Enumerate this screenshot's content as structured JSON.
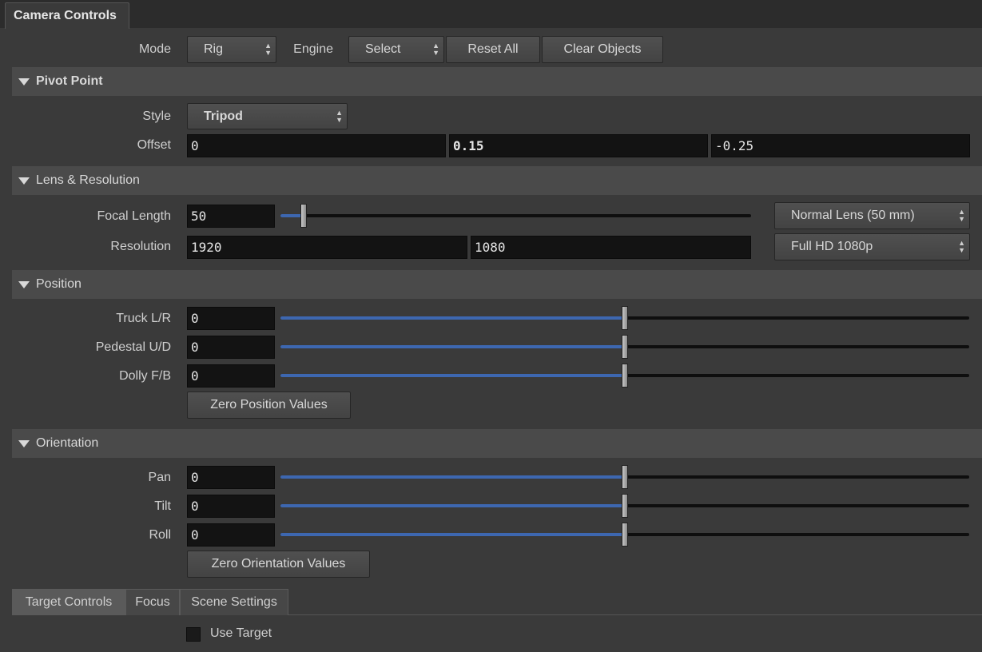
{
  "window": {
    "tab_title": "Camera Controls"
  },
  "toolbar": {
    "mode_label": "Mode",
    "mode_value": "Rig",
    "engine_label": "Engine",
    "engine_value": "Select",
    "reset_all": "Reset All",
    "clear_objects": "Clear Objects"
  },
  "pivot": {
    "title": "Pivot Point",
    "style_label": "Style",
    "style_value": "Tripod",
    "offset_label": "Offset",
    "offset": [
      "0",
      "0.15",
      "-0.25"
    ]
  },
  "lens": {
    "title": "Lens & Resolution",
    "focal_label": "Focal Length",
    "focal_value": "50",
    "focal_slider_fraction": 0.05,
    "lens_preset": "Normal Lens (50 mm)",
    "resolution_label": "Resolution",
    "res_w": "1920",
    "res_h": "1080",
    "res_preset": "Full HD 1080p"
  },
  "position": {
    "title": "Position",
    "rows": [
      {
        "label": "Truck L/R",
        "value": "0",
        "fraction": 0.5
      },
      {
        "label": "Pedestal U/D",
        "value": "0",
        "fraction": 0.5
      },
      {
        "label": "Dolly F/B",
        "value": "0",
        "fraction": 0.5
      }
    ],
    "zero_button": "Zero Position Values"
  },
  "orientation": {
    "title": "Orientation",
    "rows": [
      {
        "label": "Pan",
        "value": "0",
        "fraction": 0.5
      },
      {
        "label": "Tilt",
        "value": "0",
        "fraction": 0.5
      },
      {
        "label": "Roll",
        "value": "0",
        "fraction": 0.5
      }
    ],
    "zero_button": "Zero Orientation Values"
  },
  "subtabs": [
    "Target Controls",
    "Focus",
    "Scene Settings"
  ],
  "target": {
    "use_target_label": "Use Target",
    "use_target_checked": false
  },
  "icons": {
    "dropdown": "updown-arrows-icon",
    "collapse": "triangle-down-icon"
  },
  "colors": {
    "slider_fill": "#3d67b0",
    "field_bg": "#131313",
    "section_bg": "#4a4a4a"
  }
}
